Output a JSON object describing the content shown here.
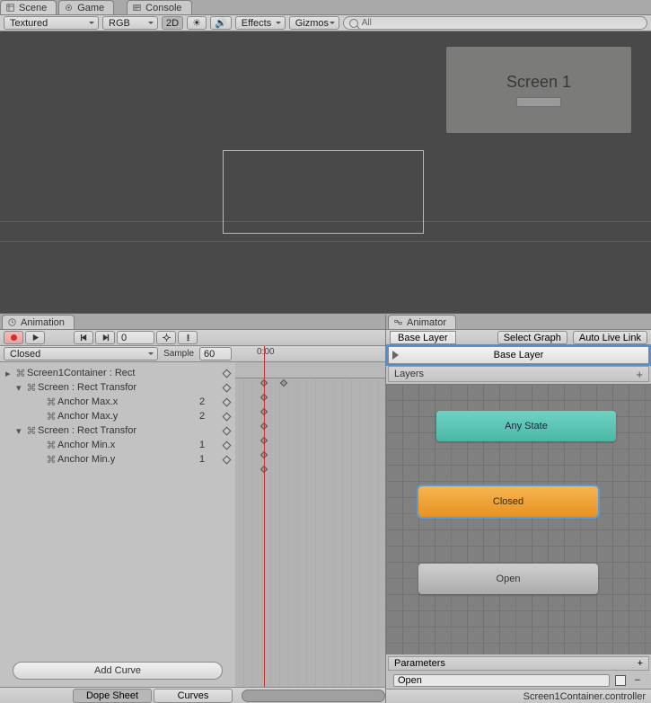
{
  "top_tabs": {
    "scene": "Scene",
    "game": "Game",
    "console": "Console"
  },
  "scene_tb": {
    "shading": "Textured",
    "channel": "RGB",
    "twod": "2D",
    "effects": "Effects",
    "gizmos": "Gizmos",
    "search_placeholder": "All"
  },
  "scene_preview": {
    "panel_title": "Screen 1"
  },
  "panel_tabs": {
    "animation": "Animation",
    "animator": "Animator"
  },
  "anim": {
    "frame": "0",
    "time_label": "0:00",
    "clip": "Closed",
    "sample_label": "Sample",
    "sample": "60",
    "props": [
      {
        "level": 0,
        "arrow": "▸",
        "name": "Screen1Container : Rect",
        "val": "",
        "key": true
      },
      {
        "level": 1,
        "arrow": "▾",
        "name": "Screen : Rect Transfor",
        "val": "",
        "key": true
      },
      {
        "level": 2,
        "arrow": "",
        "name": "Anchor Max.x",
        "val": "2",
        "key": true
      },
      {
        "level": 2,
        "arrow": "",
        "name": "Anchor Max.y",
        "val": "2",
        "key": true
      },
      {
        "level": 1,
        "arrow": "▾",
        "name": "Screen : Rect Transfor",
        "val": "",
        "key": true
      },
      {
        "level": 2,
        "arrow": "",
        "name": "Anchor Min.x",
        "val": "1",
        "key": true
      },
      {
        "level": 2,
        "arrow": "",
        "name": "Anchor Min.y",
        "val": "1",
        "key": true
      }
    ],
    "add_curve": "Add Curve",
    "dope_tab": "Dope Sheet",
    "curves_tab": "Curves"
  },
  "tor": {
    "crumb": "Base Layer",
    "select_graph": "Select Graph",
    "auto_live": "Auto Live Link",
    "base_layer": "Base Layer",
    "layers": "Layers",
    "states": {
      "any": "Any State",
      "closed": "Closed",
      "open": "Open"
    },
    "parameters": "Parameters",
    "param_name": "Open",
    "status": "Screen1Container.controller"
  }
}
